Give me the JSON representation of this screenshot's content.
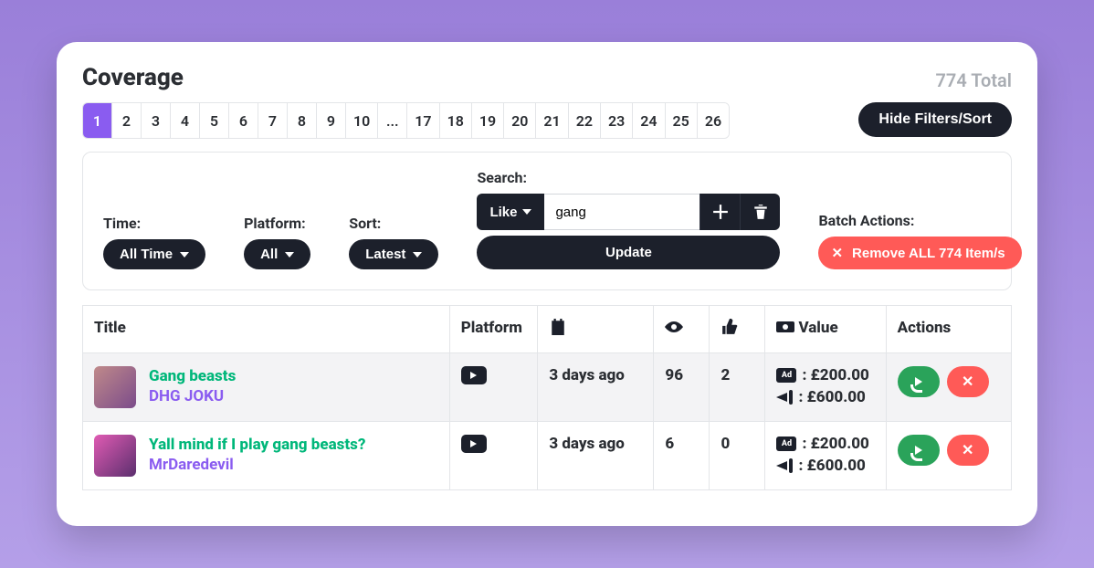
{
  "header": {
    "title": "Coverage",
    "total_label": "774 Total"
  },
  "pagination": {
    "active": "1",
    "pages": [
      "1",
      "2",
      "3",
      "4",
      "5",
      "6",
      "7",
      "8",
      "9",
      "10",
      "...",
      "17",
      "18",
      "19",
      "20",
      "21",
      "22",
      "23",
      "24",
      "25",
      "26"
    ]
  },
  "hide_filters_label": "Hide Filters/Sort",
  "filters": {
    "time": {
      "label": "Time:",
      "value": "All Time"
    },
    "platform": {
      "label": "Platform:",
      "value": "All"
    },
    "sort": {
      "label": "Sort:",
      "value": "Latest"
    },
    "search": {
      "label": "Search:",
      "mode": "Like",
      "value": "gang",
      "update_label": "Update"
    },
    "batch": {
      "label": "Batch Actions:",
      "remove_label": "Remove ALL 774 Item/s"
    }
  },
  "table": {
    "headers": {
      "title": "Title",
      "platform": "Platform",
      "date_icon": "calendar-icon",
      "views_icon": "eye-icon",
      "likes_icon": "thumbs-up-icon",
      "value": "Value",
      "value_icon": "money-icon",
      "actions": "Actions"
    },
    "rows": [
      {
        "title": "Gang beasts",
        "channel": "DHG JOKU",
        "platform_icon": "youtube-icon",
        "date": "3 days ago",
        "views": "96",
        "likes": "2",
        "ad_value": ": £200.00",
        "promo_value": ": £600.00"
      },
      {
        "title": "Yall mind if I play gang beasts?",
        "channel": "MrDaredevil",
        "platform_icon": "youtube-icon",
        "date": "3 days ago",
        "views": "6",
        "likes": "0",
        "ad_value": ": £200.00",
        "promo_value": ": £600.00"
      }
    ]
  }
}
